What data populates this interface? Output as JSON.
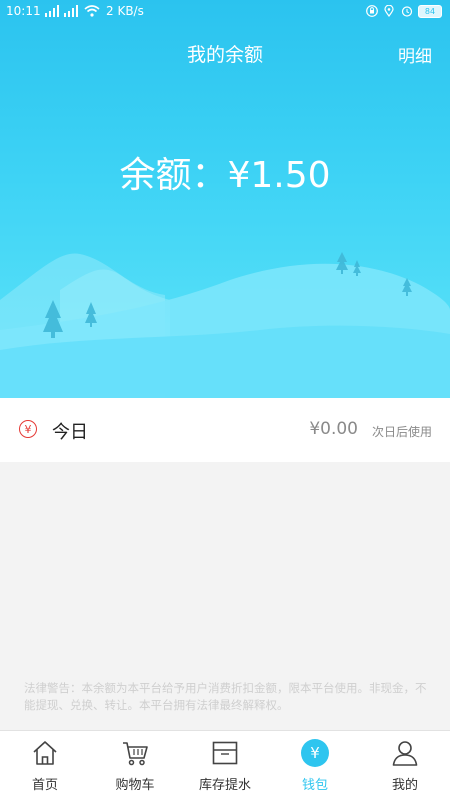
{
  "status_bar": {
    "time": "10:11",
    "network_speed": "2 KB/s",
    "battery": "84"
  },
  "header": {
    "title": "我的余额",
    "detail_label": "明细"
  },
  "balance": {
    "text": "余额：¥1.50"
  },
  "today": {
    "icon_glyph": "¥",
    "label": "今日",
    "amount": "¥0.00",
    "note": "次日后使用"
  },
  "legal_notice": "法律警告：本余额为本平台给予用户消费折扣金额，限本平台使用。非现金，不能提现、兑换、转让。本平台拥有法律最终解释权。",
  "tabbar": {
    "active_color": "#2ec5ef",
    "items": [
      {
        "label": "首页",
        "icon": "home-icon"
      },
      {
        "label": "购物车",
        "icon": "cart-icon"
      },
      {
        "label": "库存提水",
        "icon": "box-icon"
      },
      {
        "label": "钱包",
        "icon": "wallet-icon",
        "glyph": "¥"
      },
      {
        "label": "我的",
        "icon": "user-icon"
      }
    ]
  }
}
